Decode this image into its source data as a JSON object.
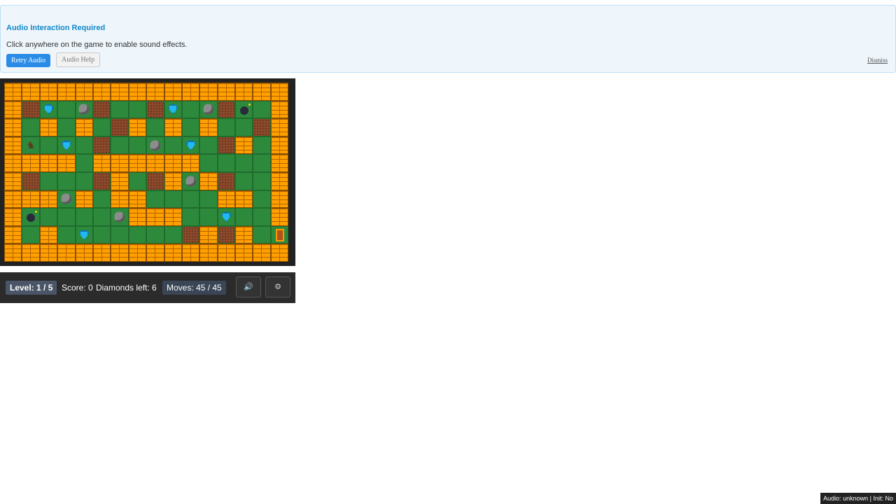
{
  "banner": {
    "title": "Audio Interaction Required",
    "message": "Click anywhere on the game to enable sound effects.",
    "retry_label": "Retry Audio",
    "help_label": "Audio Help",
    "dismiss_label": "Dismiss"
  },
  "board": {
    "legend": {
      "W": "wall",
      ".": "floor",
      "D": "dirt",
      "G": "diamond",
      "R": "rock",
      "B": "bomb",
      "P": "player",
      "E": "exit-door"
    },
    "rows": [
      "WWWWWWWWWWWWWWWW",
      "WDG.RD..DG.RDB.W",
      "W.W.W.DW.W.W..DW",
      "WP.G.D..R.G.DW.W",
      "WWWW.WWWWWW....W",
      "WD...DW.DWRWD..W",
      "WWWRW.WW....WW.W",
      "WB....RWWW..G..W",
      "W.W.G.....DWDW.E",
      "WWWWWWWWWWWWWWWW"
    ]
  },
  "status": {
    "level": "Level: 1 / 5",
    "score": "Score: 0",
    "diamonds": "Diamonds left: 6",
    "moves": "Moves: 45 / 45",
    "sound_icon": "🔊",
    "settings_icon": "⚙"
  },
  "footer": {
    "audio_status": "Audio: unknown | Init: No"
  }
}
